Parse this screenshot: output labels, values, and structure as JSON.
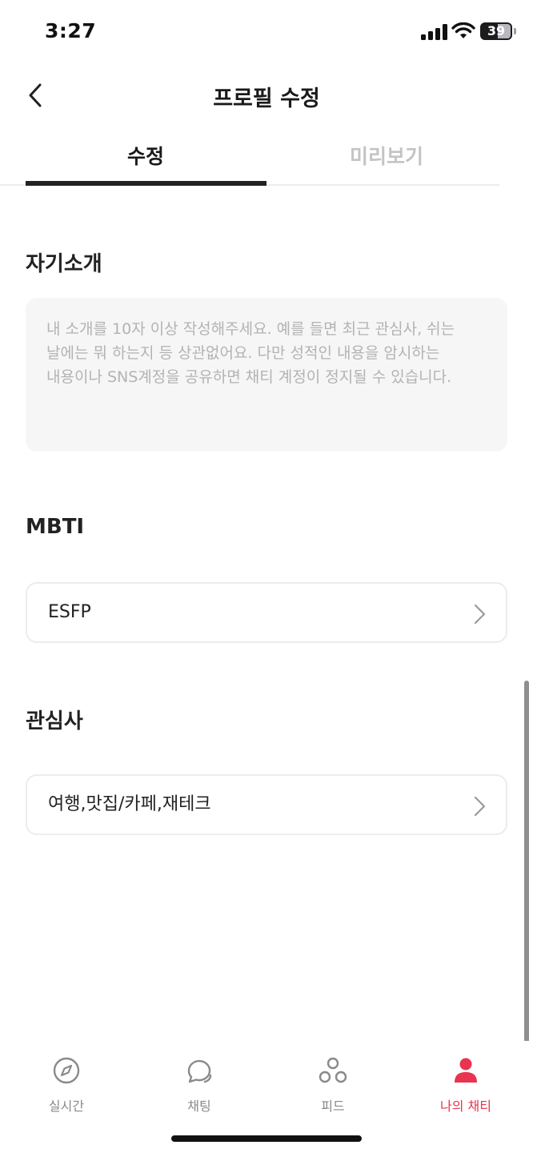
{
  "status_bar": {
    "time": "3:27",
    "battery": "39"
  },
  "header": {
    "title": "프로필 수정",
    "back_icon": "chevron-left-icon"
  },
  "tabs": [
    {
      "label": "수정",
      "active": true
    },
    {
      "label": "미리보기",
      "active": false
    }
  ],
  "intro": {
    "label": "자기소개",
    "placeholder": "내 소개를 10자 이상 작성해주세요. 예를 들면 최근 관심사, 쉬는 날에는 뭐 하는지 등 상관없어요. 다만 성적인 내용을 암시하는 내용이나 SNS계정을 공유하면 채티 계정이 정지될 수 있습니다."
  },
  "mbti": {
    "label": "MBTI",
    "value": "ESFP"
  },
  "interests": {
    "label": "관심사",
    "value": "여행,맛집/카페,재테크"
  },
  "bottom_nav": {
    "items": [
      {
        "label": "실시간",
        "icon": "compass-icon",
        "active": false
      },
      {
        "label": "채팅",
        "icon": "chat-bubbles-icon",
        "active": false
      },
      {
        "label": "피드",
        "icon": "feed-circles-icon",
        "active": false
      },
      {
        "label": "나의 채티",
        "icon": "person-icon",
        "active": true
      }
    ],
    "active_color": "#e8344e",
    "inactive_color": "#8a8a8a"
  }
}
